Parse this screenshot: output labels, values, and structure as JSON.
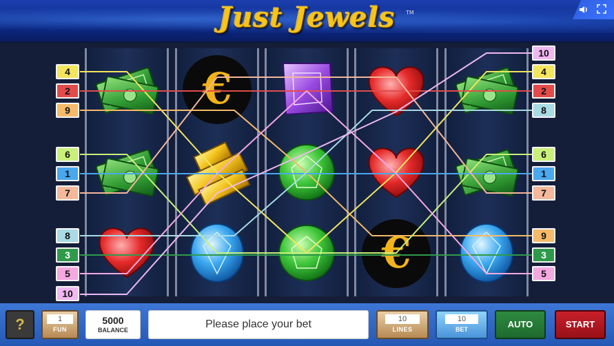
{
  "game": {
    "title": "Just Jewels",
    "trademark": "TM",
    "sound_icon": "speaker-icon",
    "fullscreen_icon": "fullscreen-icon"
  },
  "reels": [
    [
      "money",
      "money",
      "heart"
    ],
    [
      "euro",
      "gold",
      "diamond"
    ],
    [
      "amethyst",
      "emerald",
      "emerald"
    ],
    [
      "heart",
      "heart",
      "euro"
    ],
    [
      "money",
      "money",
      "diamond"
    ]
  ],
  "paylines": {
    "left": [
      {
        "num": "4",
        "color": "#f3e65e"
      },
      {
        "num": "2",
        "color": "#e34b4b"
      },
      {
        "num": "9",
        "color": "#f5ba6a"
      },
      {
        "num": "6",
        "color": "#c9f07a"
      },
      {
        "num": "1",
        "color": "#4aa8ee"
      },
      {
        "num": "7",
        "color": "#f5b89a"
      },
      {
        "num": "8",
        "color": "#a8dbe4"
      },
      {
        "num": "3",
        "color": "#2f9a4a"
      },
      {
        "num": "5",
        "color": "#f4a8e0"
      },
      {
        "num": "10",
        "color": "#f0b8f0"
      }
    ],
    "right": [
      {
        "num": "10",
        "color": "#f0b8f0"
      },
      {
        "num": "4",
        "color": "#f3e65e"
      },
      {
        "num": "2",
        "color": "#e34b4b"
      },
      {
        "num": "8",
        "color": "#a8dbe4"
      },
      {
        "num": "6",
        "color": "#c9f07a"
      },
      {
        "num": "1",
        "color": "#4aa8ee"
      },
      {
        "num": "7",
        "color": "#f5b89a"
      },
      {
        "num": "9",
        "color": "#f5ba6a"
      },
      {
        "num": "3",
        "color": "#2f9a4a"
      },
      {
        "num": "5",
        "color": "#f4a8e0"
      }
    ]
  },
  "controls": {
    "help_label": "?",
    "fun_value": "1",
    "fun_label": "FUN",
    "balance_value": "5000",
    "balance_label": "BALANCE",
    "message": "Please place your bet",
    "lines_value": "10",
    "lines_label": "LINES",
    "bet_value": "10",
    "bet_label": "BET",
    "auto_label": "AUTO",
    "start_label": "START"
  }
}
